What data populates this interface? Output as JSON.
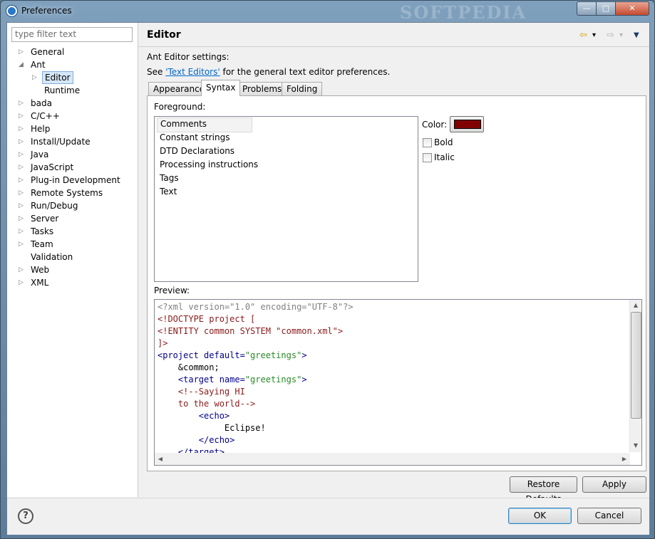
{
  "window": {
    "title": "Preferences",
    "watermark": "SOFTPEDIA"
  },
  "titlebar_buttons": {
    "minimize": "—",
    "maximize": "□",
    "close": "✕"
  },
  "sidebar": {
    "filter_placeholder": "type filter text",
    "items": [
      {
        "label": "General",
        "arrow": "▷"
      },
      {
        "label": "Ant",
        "arrow": "◢"
      },
      {
        "label": "Editor",
        "arrow": "▷"
      },
      {
        "label": "Runtime",
        "arrow": ""
      },
      {
        "label": "bada",
        "arrow": "▷"
      },
      {
        "label": "C/C++",
        "arrow": "▷"
      },
      {
        "label": "Help",
        "arrow": "▷"
      },
      {
        "label": "Install/Update",
        "arrow": "▷"
      },
      {
        "label": "Java",
        "arrow": "▷"
      },
      {
        "label": "JavaScript",
        "arrow": "▷"
      },
      {
        "label": "Plug-in Development",
        "arrow": "▷"
      },
      {
        "label": "Remote Systems",
        "arrow": "▷"
      },
      {
        "label": "Run/Debug",
        "arrow": "▷"
      },
      {
        "label": "Server",
        "arrow": "▷"
      },
      {
        "label": "Tasks",
        "arrow": "▷"
      },
      {
        "label": "Team",
        "arrow": "▷"
      },
      {
        "label": "Validation",
        "arrow": ""
      },
      {
        "label": "Web",
        "arrow": "▷"
      },
      {
        "label": "XML",
        "arrow": "▷"
      }
    ]
  },
  "main": {
    "title": "Editor",
    "nav": {
      "back": "⇦",
      "back_menu": "▾",
      "forward": "⇨",
      "forward_menu": "▾",
      "view_menu": "▼"
    },
    "settings_label": "Ant Editor settings:",
    "see_prefix": "See ",
    "see_link": "'Text Editors'",
    "see_suffix": " for the general text editor preferences.",
    "tabs": [
      "Appearance",
      "Syntax",
      "Problems",
      "Folding"
    ],
    "active_tab": "Syntax",
    "foreground_label": "Foreground:",
    "foreground_items": [
      "Comments",
      "Constant strings",
      "DTD Declarations",
      "Processing instructions",
      "Tags",
      "Text"
    ],
    "selected_foreground": "Comments",
    "color_label": "Color:",
    "color_value": "#800000",
    "bold_label": "Bold",
    "italic_label": "Italic",
    "preview_label": "Preview:",
    "preview_lines": [
      [
        {
          "t": "<?xml version=\"1.0\" encoding=\"UTF-8\"?>",
          "c": "gray"
        }
      ],
      [
        {
          "t": "<!DOCTYPE project [",
          "c": "maroon"
        }
      ],
      [
        {
          "t": "<!ENTITY common SYSTEM \"common.xml\">",
          "c": "maroon"
        }
      ],
      [
        {
          "t": "]>",
          "c": "maroon"
        }
      ],
      [
        {
          "t": "<project default=",
          "c": "navy"
        },
        {
          "t": "\"greetings\"",
          "c": "green"
        },
        {
          "t": ">",
          "c": "navy"
        }
      ],
      [
        {
          "t": "    &common;",
          "c": "black"
        }
      ],
      [
        {
          "t": "    <target name=",
          "c": "navy"
        },
        {
          "t": "\"greetings\"",
          "c": "green"
        },
        {
          "t": ">",
          "c": "navy"
        }
      ],
      [
        {
          "t": "    <!--Saying HI",
          "c": "maroon"
        }
      ],
      [
        {
          "t": "    to the world-->",
          "c": "maroon"
        }
      ],
      [
        {
          "t": "        <echo>",
          "c": "navy"
        }
      ],
      [
        {
          "t": "             Eclipse!",
          "c": "black"
        }
      ],
      [
        {
          "t": "        </echo>",
          "c": "navy"
        }
      ],
      [
        {
          "t": "    </target>",
          "c": "navy"
        }
      ]
    ],
    "restore_defaults_label": "Restore Defaults",
    "apply_label": "Apply"
  },
  "footer": {
    "help_symbol": "?",
    "ok_label": "OK",
    "cancel_label": "Cancel"
  }
}
